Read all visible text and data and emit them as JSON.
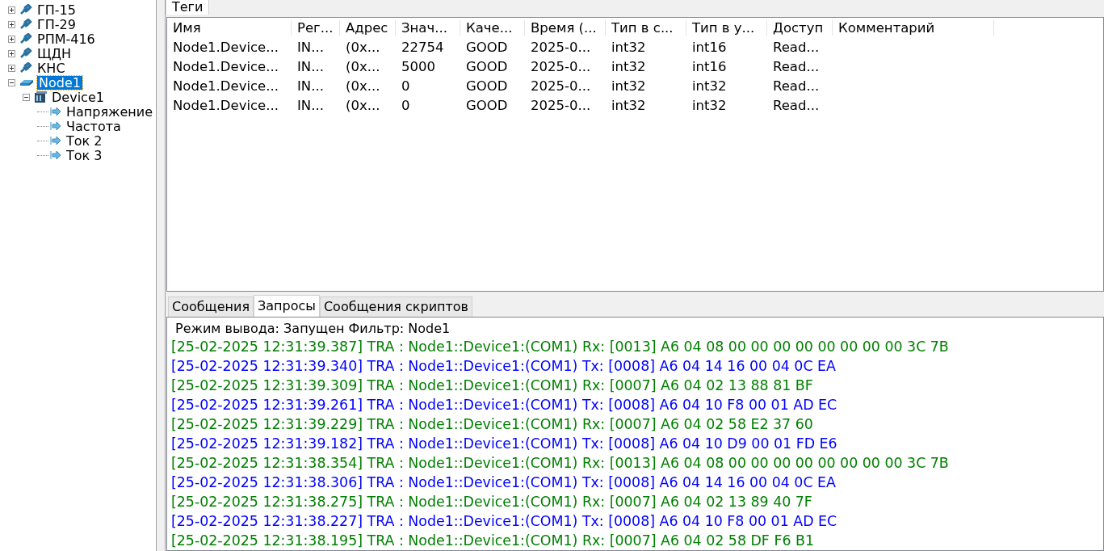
{
  "tree": [
    {
      "label": "ГП-15",
      "kind": "node",
      "expanded": false,
      "selected": false
    },
    {
      "label": "ГП-29",
      "kind": "node",
      "expanded": false,
      "selected": false
    },
    {
      "label": "РПМ-416",
      "kind": "node",
      "expanded": false,
      "selected": false
    },
    {
      "label": "ЩДН",
      "kind": "node",
      "expanded": false,
      "selected": false
    },
    {
      "label": "КНС",
      "kind": "node",
      "expanded": false,
      "selected": false
    },
    {
      "label": "Node1",
      "kind": "port",
      "expanded": true,
      "selected": true,
      "children": [
        {
          "label": "Device1",
          "kind": "device",
          "expanded": true,
          "selected": false,
          "children": [
            {
              "label": "Напряжение",
              "kind": "tag",
              "selected": false
            },
            {
              "label": "Частота",
              "kind": "tag",
              "selected": false
            },
            {
              "label": "Ток 2",
              "kind": "tag",
              "selected": false
            },
            {
              "label": "Ток 3",
              "kind": "tag",
              "selected": false
            }
          ]
        }
      ]
    }
  ],
  "top_tabs": [
    {
      "label": "Теги",
      "selected": true
    }
  ],
  "table": {
    "columns": [
      "Имя",
      "Рег...",
      "Адрес",
      "Знач...",
      "Каче...",
      "Время (...",
      "Тип в с...",
      "Тип в у...",
      "Доступ",
      "Комментарий"
    ],
    "rows": [
      [
        "Node1.Device...",
        "IN...",
        "(0x...",
        "22754",
        "GOOD",
        "2025-0...",
        "int32",
        "int16",
        "Read..."
      ],
      [
        "Node1.Device...",
        "IN...",
        "(0x...",
        "5000",
        "GOOD",
        "2025-0...",
        "int32",
        "int16",
        "Read..."
      ],
      [
        "Node1.Device...",
        "IN...",
        "(0x...",
        "0",
        "GOOD",
        "2025-0...",
        "int32",
        "int32",
        "Read..."
      ],
      [
        "Node1.Device...",
        "IN...",
        "(0x...",
        "0",
        "GOOD",
        "2025-0...",
        "int32",
        "int32",
        "Read..."
      ]
    ]
  },
  "bottom_tabs": [
    {
      "label": "Сообщения",
      "selected": false
    },
    {
      "label": "Запросы",
      "selected": true
    },
    {
      "label": "Сообщения скриптов",
      "selected": false
    }
  ],
  "log": {
    "header": "Режим вывода: Запущен Фильтр: Node1",
    "lines": [
      {
        "text": "[25-02-2025 12:31:39.387] TRA : Node1::Device1:(COM1) Rx: [0013] A6 04 08 00 00 00 00 00 00 00 00 3C 7B",
        "color": "#008000"
      },
      {
        "text": "[25-02-2025 12:31:39.340] TRA : Node1::Device1:(COM1) Tx: [0008] A6 04 14 16 00 04 0C EA",
        "color": "#0000ff"
      },
      {
        "text": "[25-02-2025 12:31:39.309] TRA : Node1::Device1:(COM1) Rx: [0007] A6 04 02 13 88 81 BF",
        "color": "#008000"
      },
      {
        "text": "[25-02-2025 12:31:39.261] TRA : Node1::Device1:(COM1) Tx: [0008] A6 04 10 F8 00 01 AD EC",
        "color": "#0000ff"
      },
      {
        "text": "[25-02-2025 12:31:39.229] TRA : Node1::Device1:(COM1) Rx: [0007] A6 04 02 58 E2 37 60",
        "color": "#008000"
      },
      {
        "text": "[25-02-2025 12:31:39.182] TRA : Node1::Device1:(COM1) Tx: [0008] A6 04 10 D9 00 01 FD E6",
        "color": "#0000ff"
      },
      {
        "text": "[25-02-2025 12:31:38.354] TRA : Node1::Device1:(COM1) Rx: [0013] A6 04 08 00 00 00 00 00 00 00 00 3C 7B",
        "color": "#008000"
      },
      {
        "text": "[25-02-2025 12:31:38.306] TRA : Node1::Device1:(COM1) Tx: [0008] A6 04 14 16 00 04 0C EA",
        "color": "#0000ff"
      },
      {
        "text": "[25-02-2025 12:31:38.275] TRA : Node1::Device1:(COM1) Rx: [0007] A6 04 02 13 89 40 7F",
        "color": "#008000"
      },
      {
        "text": "[25-02-2025 12:31:38.227] TRA : Node1::Device1:(COM1) Tx: [0008] A6 04 10 F8 00 01 AD EC",
        "color": "#0000ff"
      },
      {
        "text": "[25-02-2025 12:31:38.195] TRA : Node1::Device1:(COM1) Rx: [0007] A6 04 02 58 DF F6 B1",
        "color": "#008000"
      }
    ]
  }
}
